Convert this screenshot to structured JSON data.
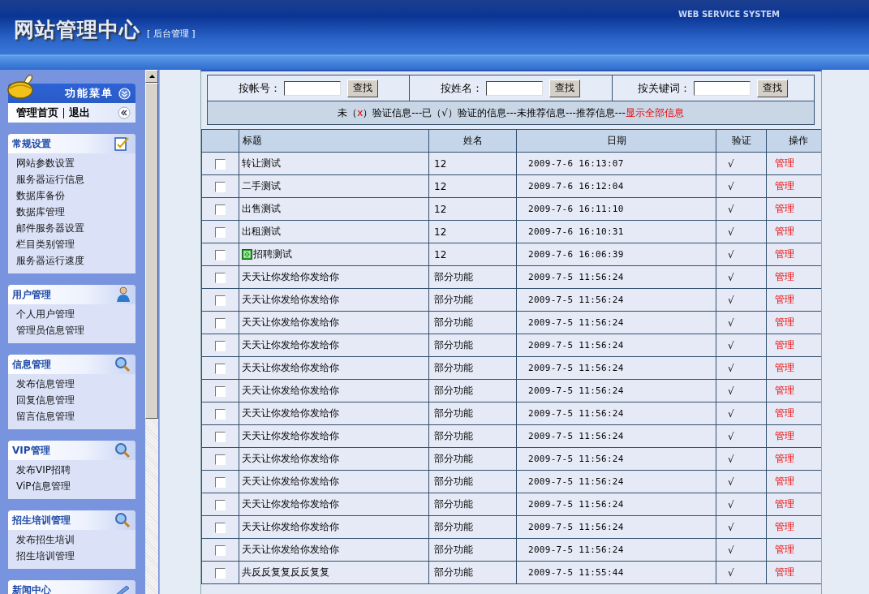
{
  "header": {
    "title": "网站管理中心",
    "subtitle": "[ 后台管理 ]",
    "tagline": "WEB SERVICE SYSTEM"
  },
  "sidebar": {
    "menu_title": "功能菜单",
    "links": [
      {
        "label": "管理首页"
      },
      {
        "label": "退出"
      }
    ],
    "groups": [
      {
        "title": "常规设置",
        "kind": "settings",
        "items": [
          "网站参数设置",
          "服务器运行信息",
          "数据库备份",
          "数据库管理",
          "邮件服务器设置",
          "栏目类别管理",
          "服务器运行速度"
        ]
      },
      {
        "title": "用户管理",
        "kind": "users",
        "items": [
          "个人用户管理",
          "管理员信息管理"
        ]
      },
      {
        "title": "信息管理",
        "kind": "search",
        "items": [
          "发布信息管理",
          "回复信息管理",
          "留言信息管理"
        ]
      },
      {
        "title": "VIP管理",
        "kind": "search",
        "items": [
          "发布VIP招聘",
          "ViP信息管理"
        ]
      },
      {
        "title": "招生培训管理",
        "kind": "search",
        "items": [
          "发布招生培训",
          "招生培训管理"
        ]
      },
      {
        "title": "新闻中心",
        "kind": "news"
      }
    ]
  },
  "search": {
    "filters": [
      {
        "label": "按帐号：",
        "button": "查找"
      },
      {
        "label": "按姓名：",
        "button": "查找"
      },
      {
        "label": "按关键词：",
        "button": "查找"
      }
    ],
    "legend": {
      "before": "未（",
      "mark": "x",
      "after": "）验证信息---已（√）验证的信息---未推荐信息---推荐信息---",
      "link": "显示全部信息"
    }
  },
  "table": {
    "columns": [
      "标题",
      "姓名",
      "日期",
      "验证",
      "操作"
    ],
    "rows": [
      {
        "checked": false,
        "image": false,
        "title": "转让测试",
        "name": "12",
        "date": "2009-7-6 16:13:07",
        "verified": "√",
        "action": "管理"
      },
      {
        "checked": false,
        "image": false,
        "title": "二手测试",
        "name": "12",
        "date": "2009-7-6 16:12:04",
        "verified": "√",
        "action": "管理"
      },
      {
        "checked": false,
        "image": false,
        "title": "出售测试",
        "name": "12",
        "date": "2009-7-6 16:11:10",
        "verified": "√",
        "action": "管理"
      },
      {
        "checked": false,
        "image": false,
        "title": "出租测试",
        "name": "12",
        "date": "2009-7-6 16:10:31",
        "verified": "√",
        "action": "管理"
      },
      {
        "checked": false,
        "image": true,
        "title": "招聘测试",
        "name": "12",
        "date": "2009-7-6 16:06:39",
        "verified": "√",
        "action": "管理"
      },
      {
        "checked": false,
        "image": false,
        "title": "天天让你发给你发给你",
        "name": "部分功能",
        "date": "2009-7-5 11:56:24",
        "verified": "√",
        "action": "管理"
      },
      {
        "checked": false,
        "image": false,
        "title": "天天让你发给你发给你",
        "name": "部分功能",
        "date": "2009-7-5 11:56:24",
        "verified": "√",
        "action": "管理"
      },
      {
        "checked": false,
        "image": false,
        "title": "天天让你发给你发给你",
        "name": "部分功能",
        "date": "2009-7-5 11:56:24",
        "verified": "√",
        "action": "管理"
      },
      {
        "checked": false,
        "image": false,
        "title": "天天让你发给你发给你",
        "name": "部分功能",
        "date": "2009-7-5 11:56:24",
        "verified": "√",
        "action": "管理"
      },
      {
        "checked": false,
        "image": false,
        "title": "天天让你发给你发给你",
        "name": "部分功能",
        "date": "2009-7-5 11:56:24",
        "verified": "√",
        "action": "管理"
      },
      {
        "checked": false,
        "image": false,
        "title": "天天让你发给你发给你",
        "name": "部分功能",
        "date": "2009-7-5 11:56:24",
        "verified": "√",
        "action": "管理"
      },
      {
        "checked": false,
        "image": false,
        "title": "天天让你发给你发给你",
        "name": "部分功能",
        "date": "2009-7-5 11:56:24",
        "verified": "√",
        "action": "管理"
      },
      {
        "checked": false,
        "image": false,
        "title": "天天让你发给你发给你",
        "name": "部分功能",
        "date": "2009-7-5 11:56:24",
        "verified": "√",
        "action": "管理"
      },
      {
        "checked": false,
        "image": false,
        "title": "天天让你发给你发给你",
        "name": "部分功能",
        "date": "2009-7-5 11:56:24",
        "verified": "√",
        "action": "管理"
      },
      {
        "checked": false,
        "image": false,
        "title": "天天让你发给你发给你",
        "name": "部分功能",
        "date": "2009-7-5 11:56:24",
        "verified": "√",
        "action": "管理"
      },
      {
        "checked": false,
        "image": false,
        "title": "天天让你发给你发给你",
        "name": "部分功能",
        "date": "2009-7-5 11:56:24",
        "verified": "√",
        "action": "管理"
      },
      {
        "checked": false,
        "image": false,
        "title": "天天让你发给你发给你",
        "name": "部分功能",
        "date": "2009-7-5 11:56:24",
        "verified": "√",
        "action": "管理"
      },
      {
        "checked": false,
        "image": false,
        "title": "天天让你发给你发给你",
        "name": "部分功能",
        "date": "2009-7-5 11:56:24",
        "verified": "√",
        "action": "管理"
      },
      {
        "checked": false,
        "image": false,
        "title": "共反反复复反反复复",
        "name": "部分功能",
        "date": "2009-7-5 11:55:44",
        "verified": "√",
        "action": "管理"
      }
    ]
  }
}
